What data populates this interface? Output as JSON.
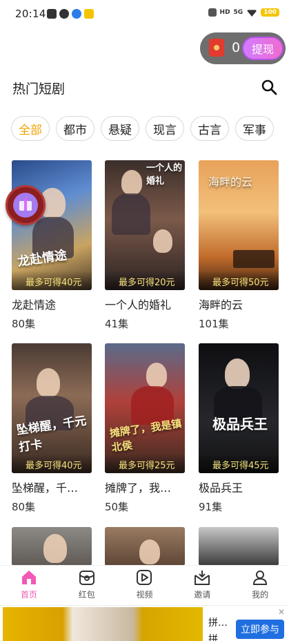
{
  "status_bar": {
    "time": "20:14",
    "hd_label": "HD",
    "signal_label": "5G",
    "battery": "100"
  },
  "reward": {
    "count": "0",
    "withdraw_label": "提现"
  },
  "section": {
    "title": "热门短剧"
  },
  "chips": [
    {
      "label": "全部",
      "active": true
    },
    {
      "label": "都市"
    },
    {
      "label": "悬疑"
    },
    {
      "label": "现言"
    },
    {
      "label": "古言"
    },
    {
      "label": "军事"
    }
  ],
  "cards": [
    {
      "name": "龙赴情途",
      "episodes": "80集",
      "earn": "最多可得40元",
      "poster_title": "龙赴情途"
    },
    {
      "name": "一个人的婚礼",
      "episodes": "41集",
      "earn": "最多可得20元",
      "poster_title": "一个人的婚礼"
    },
    {
      "name": "海畔的云",
      "episodes": "101集",
      "earn": "最多可得50元",
      "poster_title": "海畔的云"
    },
    {
      "name": "坠梯醒，千…",
      "episodes": "80集",
      "earn": "最多可得40元",
      "poster_title": "坠梯醒，千元打卡"
    },
    {
      "name": "摊牌了，我…",
      "episodes": "50集",
      "earn": "最多可得25元",
      "poster_title": "摊牌了，我是镇北侯"
    },
    {
      "name": "极品兵王",
      "episodes": "91集",
      "earn": "最多可得45元",
      "poster_title": "极品兵王"
    }
  ],
  "nav": [
    {
      "label": "首页",
      "icon": "home-icon",
      "active": true
    },
    {
      "label": "红包",
      "icon": "red-packet-icon"
    },
    {
      "label": "视频",
      "icon": "video-icon"
    },
    {
      "label": "邀请",
      "icon": "invite-icon"
    },
    {
      "label": "我的",
      "icon": "profile-icon"
    }
  ],
  "ad": {
    "text1": "拼…",
    "text2": "拼…",
    "button": "立即参与",
    "close": "✕"
  },
  "colors": {
    "accent_pink": "#f05ab4",
    "chip_active": "#f0a400",
    "ad_button": "#1f6fe0"
  }
}
